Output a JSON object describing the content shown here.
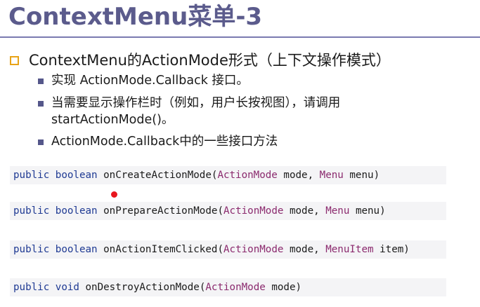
{
  "title": "ContextMenu菜单-3",
  "bullet_main": "ContextMenu的ActionMode形式（上下文操作模式）",
  "sub_bullets": [
    {
      "line1": "实现 ActionMode.Callback 接口。"
    },
    {
      "line1": "当需要显示操作栏时（例如，用户长按视图），请调用",
      "line2": "startActionMode()。"
    },
    {
      "line1": "ActionMode.Callback中的一些接口方法"
    }
  ],
  "code_lines": [
    {
      "public": "public",
      "ret": "boolean",
      "method": "onCreateActionMode",
      "p1_type": "ActionMode",
      "p1_name": "mode",
      "p2_type": "Menu",
      "p2_name": "menu"
    },
    {
      "public": "public",
      "ret": "boolean",
      "method": "onPrepareActionMode",
      "p1_type": "ActionMode",
      "p1_name": "mode",
      "p2_type": "Menu",
      "p2_name": "menu"
    },
    {
      "public": "public",
      "ret": "boolean",
      "method": "onActionItemClicked",
      "p1_type": "ActionMode",
      "p1_name": "mode",
      "p2_type": "MenuItem",
      "p2_name": "item"
    },
    {
      "public": "public",
      "ret": "void",
      "method": "onDestroyActionMode",
      "p1_type": "ActionMode",
      "p1_name": "mode"
    }
  ],
  "colors": {
    "title": "#5b5b8c",
    "rule": "#7a7ab0",
    "bullet_square": "#e8a317",
    "bullet_small": "#55578a",
    "keyword": "#1f3a93",
    "type": "#8b2a6e",
    "code_background": "#f4f4f6",
    "pointer": "#e8161e"
  }
}
